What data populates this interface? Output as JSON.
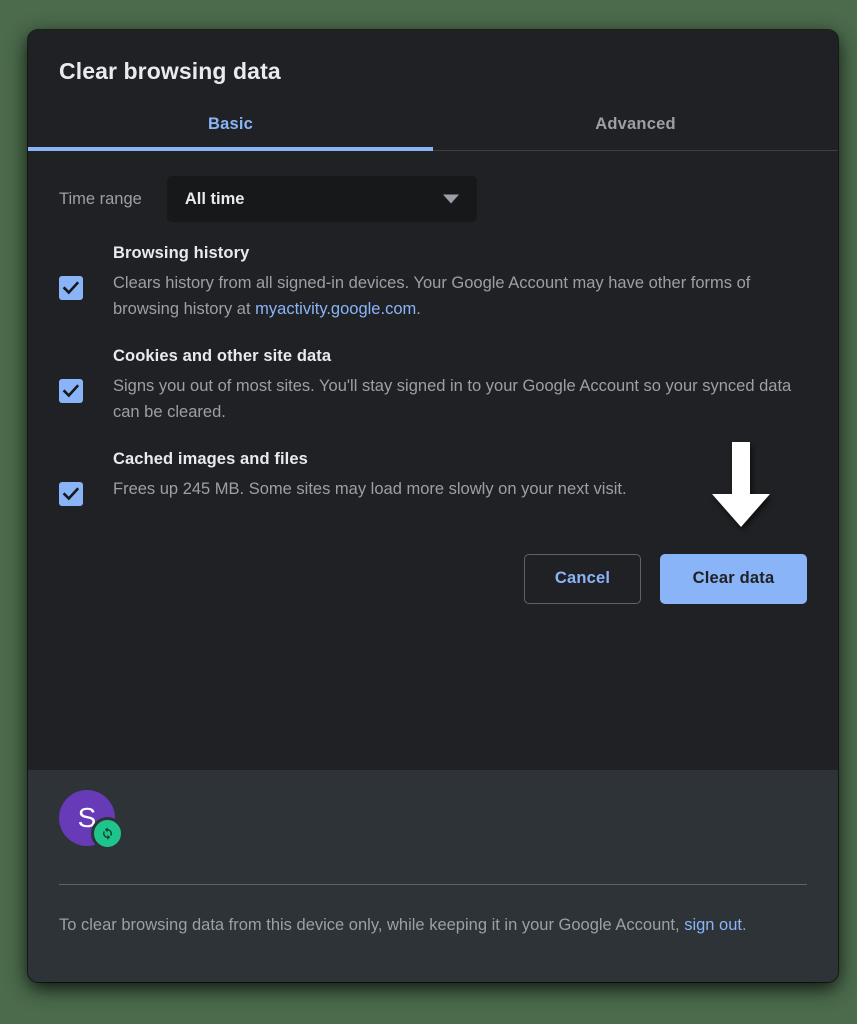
{
  "dialog": {
    "title": "Clear browsing data",
    "tabs": [
      {
        "label": "Basic",
        "active": true
      },
      {
        "label": "Advanced",
        "active": false
      }
    ],
    "time_range": {
      "label": "Time range",
      "selected": "All time",
      "caret_icon": "chevron-down-icon"
    },
    "options": [
      {
        "title": "Browsing history",
        "desc_before": "Clears history from all signed-in devices. Your Google Account may have other forms of browsing history at ",
        "link": "myactivity.google.com",
        "desc_after": ".",
        "checked": true
      },
      {
        "title": "Cookies and other site data",
        "desc_before": "Signs you out of most sites. You'll stay signed in to your Google Account so your synced data can be cleared.",
        "link": "",
        "desc_after": "",
        "checked": true
      },
      {
        "title": "Cached images and files",
        "desc_before": "Frees up 245 MB. Some sites may load more slowly on your next visit.",
        "link": "",
        "desc_after": "",
        "checked": true
      }
    ],
    "actions": {
      "cancel_label": "Cancel",
      "confirm_label": "Clear data",
      "pointer_icon": "down-arrow-annotation"
    },
    "footer": {
      "avatar_initial": "S",
      "sync_icon": "sync-refresh-icon",
      "text_before": "To clear browsing data from this device only, while keeping it in your Google Account, ",
      "link": "sign out",
      "text_after": "."
    }
  },
  "colors": {
    "accent": "#8ab4f8",
    "dialog_bg": "#202124",
    "footer_bg": "#2d3336",
    "page_bg": "#4b6b4c",
    "avatar_bg": "#673ab7",
    "sync_badge": "#1fc48d",
    "text_primary": "#e8eaed",
    "text_secondary": "#9aa0a6"
  }
}
